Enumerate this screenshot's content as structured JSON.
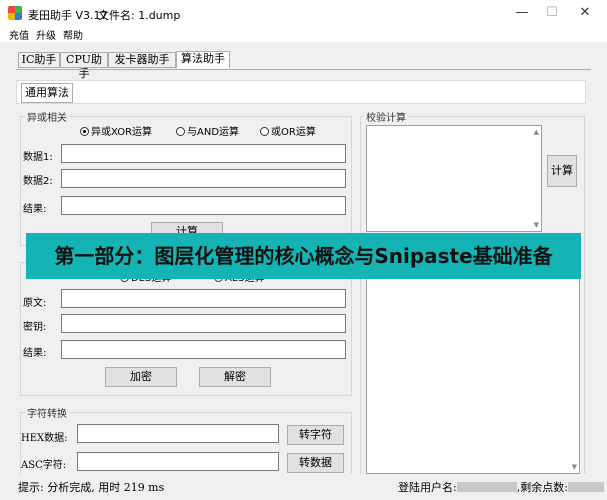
{
  "window": {
    "app_name": "麦田助手 V3.17",
    "file_label": "文件名: 1.dump",
    "controls": {
      "minimize": "—",
      "maximize": "☐",
      "close": "✕"
    },
    "icon_colors": [
      "#e74c3c",
      "#3cb44b",
      "#f5b400",
      "#2d7dd2"
    ]
  },
  "menu": {
    "items": [
      "充值",
      "升级",
      "帮助"
    ]
  },
  "tabs": [
    {
      "label": "IC助手",
      "active": false
    },
    {
      "label": "CPU助手",
      "active": false
    },
    {
      "label": "发卡器助手",
      "active": false
    },
    {
      "label": "算法助手",
      "active": true
    }
  ],
  "subtab": {
    "label": "通用算法"
  },
  "xor_group": {
    "title": "异或相关",
    "radios": [
      {
        "label": "异或XOR运算",
        "selected": true
      },
      {
        "label": "与AND运算",
        "selected": false
      },
      {
        "label": "或OR运算",
        "selected": false
      }
    ],
    "fields": [
      {
        "label": "数据1:",
        "value": ""
      },
      {
        "label": "数据2:",
        "value": ""
      },
      {
        "label": "结果:",
        "value": ""
      }
    ],
    "compute_button": "计算"
  },
  "crypto_group": {
    "radios": [
      {
        "label": "DES运算",
        "selected": true
      },
      {
        "label": "AES运算",
        "selected": false
      }
    ],
    "fields": [
      {
        "label": "原文:",
        "value": ""
      },
      {
        "label": "密钥:",
        "value": ""
      },
      {
        "label": "结果:",
        "value": ""
      }
    ],
    "encrypt_button": "加密",
    "decrypt_button": "解密"
  },
  "convert_group": {
    "title": "字符转换",
    "fields": [
      {
        "label": "HEX数据:",
        "value": "",
        "button": "转字符"
      },
      {
        "label": "ASC字符:",
        "value": "",
        "button": "转数据"
      }
    ]
  },
  "checksum_group": {
    "title": "校验计算",
    "compute_button": "计算"
  },
  "banner": {
    "text": "第一部分：图层化管理的核心概念与Snipaste基础准备",
    "bg_color": "#14b4b4"
  },
  "status": {
    "left_text": "提示: 分析完成, 用时 219 ms",
    "user_label": "登陆用户名:",
    "points_label": ",剩余点数:"
  }
}
